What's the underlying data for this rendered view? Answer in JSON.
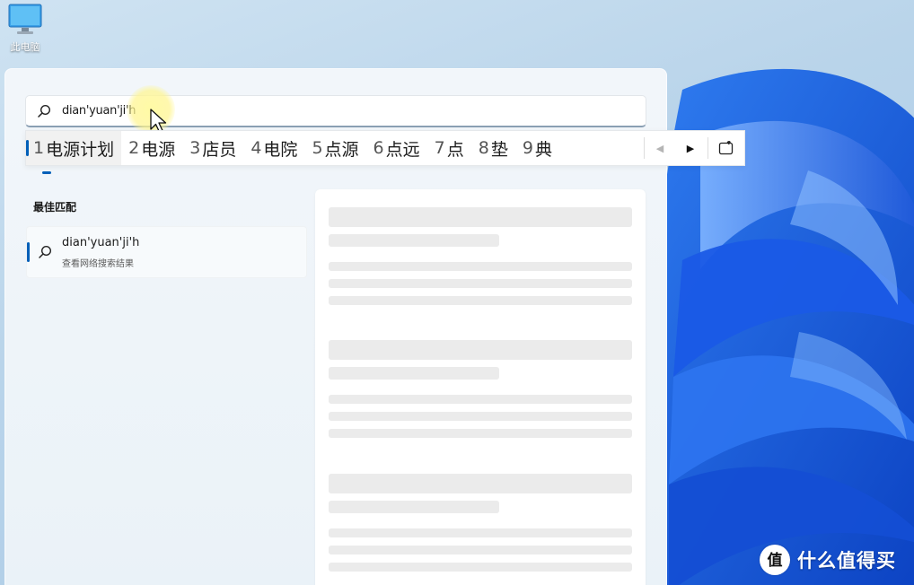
{
  "desktop": {
    "icons": [
      {
        "label": "此电脑",
        "icon": "computer-icon"
      }
    ]
  },
  "start_menu": {
    "search": {
      "value": "dian'yuan'ji'h",
      "icon": "search-icon"
    },
    "ime": {
      "candidates": [
        {
          "num": "1",
          "text": "电源计划"
        },
        {
          "num": "2",
          "text": "电源"
        },
        {
          "num": "3",
          "text": "店员"
        },
        {
          "num": "4",
          "text": "电院"
        },
        {
          "num": "5",
          "text": "点源"
        },
        {
          "num": "6",
          "text": "点远"
        },
        {
          "num": "7",
          "text": "点"
        },
        {
          "num": "8",
          "text": "垫"
        },
        {
          "num": "9",
          "text": "典"
        }
      ],
      "nav_prev": "◀",
      "nav_next": "▶",
      "emoji_icon": "emoji-panel-icon"
    },
    "best_match": {
      "section_title": "最佳匹配",
      "title": "dian'yuan'ji'h",
      "subtitle": "查看网络搜索结果"
    }
  },
  "watermark": {
    "text": "什么值得买",
    "icon": "zhi-logo-icon"
  },
  "colors": {
    "accent": "#005fb8",
    "wallpaper_blue": "#1f5fe0"
  }
}
